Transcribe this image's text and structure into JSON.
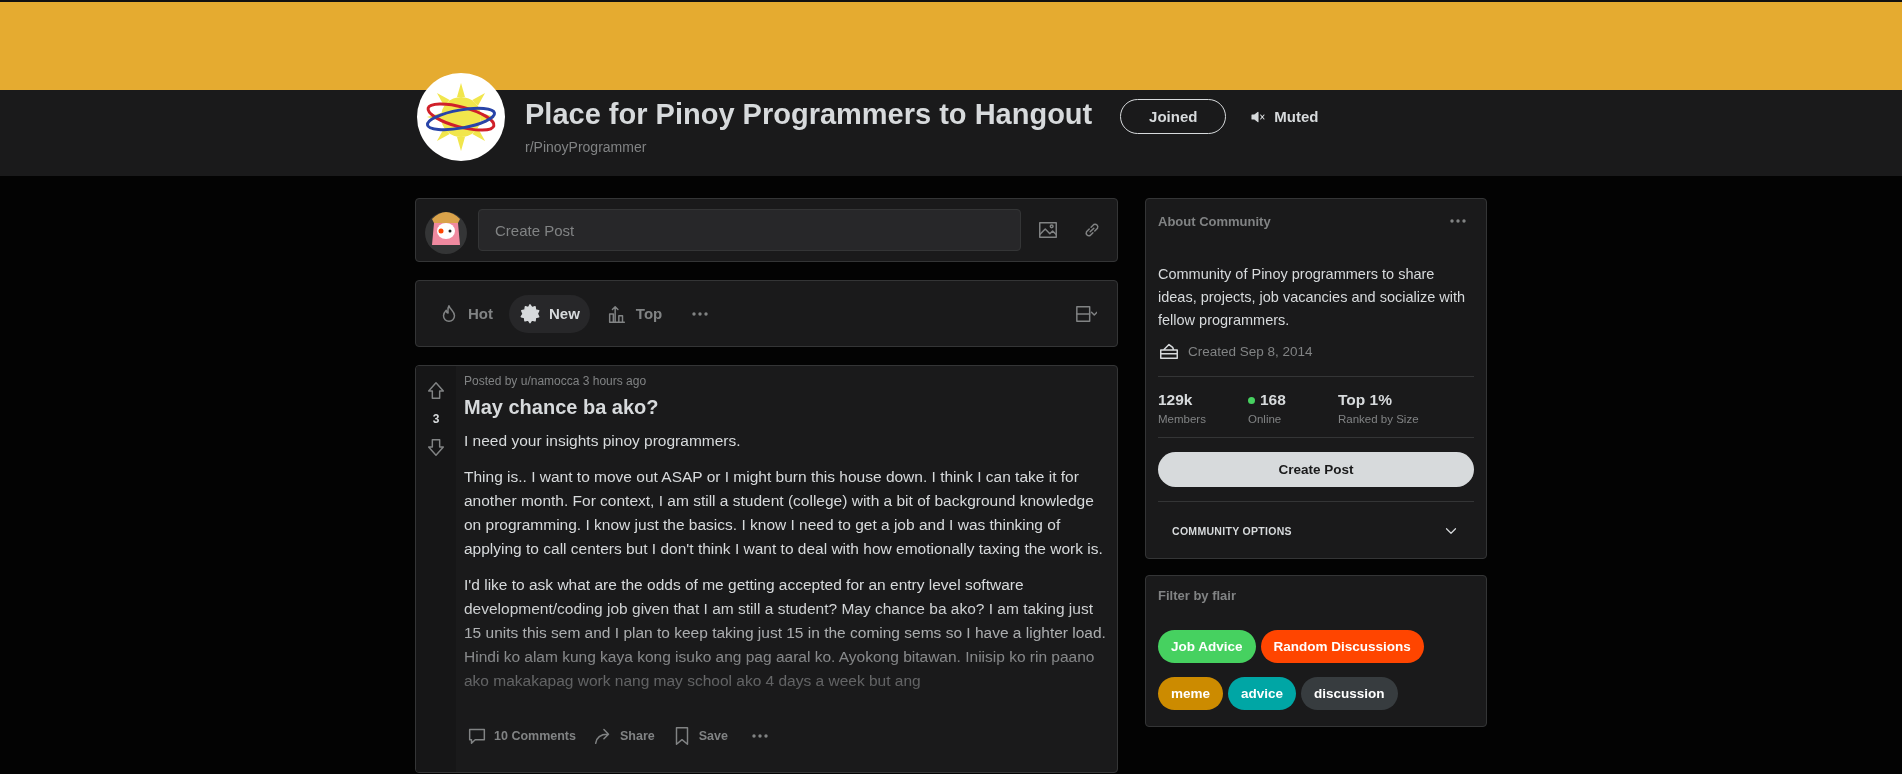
{
  "banner": {
    "title": "Place for Pinoy Programmers to Hangout",
    "subreddit": "r/PinoyProgrammer"
  },
  "join_button": {
    "label": "Joined",
    "selected": true
  },
  "mute_button": {
    "label": "Muted",
    "on": true
  },
  "create_post": {
    "placeholder": "Create Post"
  },
  "sort_tabs": [
    {
      "kind": "hot",
      "label": "Hot",
      "selected": false
    },
    {
      "kind": "new",
      "label": "New",
      "selected": true
    },
    {
      "kind": "top",
      "label": "Top",
      "selected": false
    }
  ],
  "post": {
    "meta": "Posted by u/namocca 3 hours ago",
    "votes": "3",
    "title": "May chance ba ako?",
    "paragraphs": [
      "I need your insights pinoy programmers.",
      "Thing is.. I want to move out ASAP or I might burn this house down. I think I can take it for another month. For context, I am still a student (college) with a bit of background knowledge on programming. I know just the basics. I know I need to get a job and I was thinking of applying to call centers but I don't think I want to deal with how emotionally taxing the work is.",
      "I'd like to ask what are the odds of me getting accepted for an entry level software development/coding job given that I am still a student? May chance ba ako? I am taking just 15 units this sem and I plan to keep taking just 15 in the coming sems so I have a lighter load. Hindi ko alam kung kaya kong isuko ang pag aaral ko. Ayokong bitawan. Iniisip ko rin paano ako makakapag work nang may school ako 4 days a week but ang"
    ],
    "actions": [
      {
        "kind": "comments",
        "label": "10 Comments"
      },
      {
        "kind": "share",
        "label": "Share"
      },
      {
        "kind": "save",
        "label": "Save"
      }
    ]
  },
  "about": {
    "heading": "About Community",
    "description": "Community of Pinoy programmers to share ideas, projects, job vacancies and socialize with fellow programmers.",
    "created": "Created Sep 8, 2014",
    "stats": [
      {
        "kind": "plain",
        "value": "129k",
        "label": "Members"
      },
      {
        "kind": "online",
        "value": "168",
        "label": "Online"
      },
      {
        "kind": "plain",
        "value": "Top 1%",
        "label": "Ranked by Size"
      }
    ],
    "button": "Create Post",
    "options": "COMMUNITY OPTIONS"
  },
  "flair": {
    "heading": "Filter by flair",
    "items": [
      {
        "label": "Job Advice",
        "color": "#46d160"
      },
      {
        "label": "Random Discussions",
        "color": "#ff4500"
      },
      {
        "label": "meme",
        "color": "#cc8b00"
      },
      {
        "label": "advice",
        "color": "#00a6a5"
      },
      {
        "label": "discussion",
        "color": "#373c3f"
      }
    ]
  }
}
